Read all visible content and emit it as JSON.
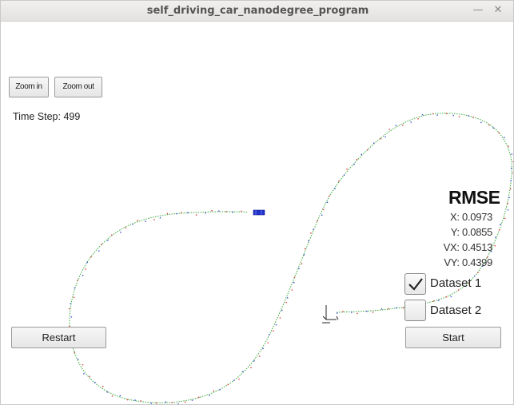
{
  "window": {
    "title": "self_driving_car_nanodegree_program",
    "minimize_icon": "minimize-icon",
    "close_icon": "close-icon"
  },
  "controls": {
    "zoom_in_label": "Zoom in",
    "zoom_out_label": "Zoom out",
    "restart_label": "Restart",
    "start_label": "Start"
  },
  "status": {
    "time_step_text": "Time Step: 499"
  },
  "rmse": {
    "title": "RMSE",
    "x": "X: 0.0973",
    "y": "Y: 0.0855",
    "vx": "VX: 0.4513",
    "vy": "VY: 0.4399"
  },
  "datasets": [
    {
      "label": "Dataset 1",
      "checked": true
    },
    {
      "label": "Dataset 2",
      "checked": false
    }
  ],
  "colors": {
    "trajectory": "#3aa83a",
    "lidar_marker": "#e03a3a",
    "radar_marker": "#3a4bd8",
    "car": "#2233cc"
  }
}
